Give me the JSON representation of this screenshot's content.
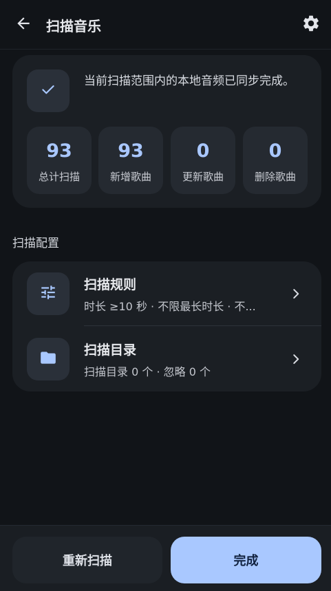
{
  "header": {
    "title": "扫描音乐",
    "back_icon": "arrow-back-icon",
    "settings_icon": "gear-icon"
  },
  "summary": {
    "message": "当前扫描范围内的本地音频已同步完成。",
    "status_icon": "checkmark-icon",
    "stats": [
      {
        "value": "93",
        "label": "总计扫描"
      },
      {
        "value": "93",
        "label": "新增歌曲"
      },
      {
        "value": "0",
        "label": "更新歌曲"
      },
      {
        "value": "0",
        "label": "删除歌曲"
      }
    ]
  },
  "config": {
    "section_title": "扫描配置",
    "items": [
      {
        "title": "扫描规则",
        "subtitle": "时长 ≥10 秒 · 不限最长时长 · 不...",
        "icon": "tune-sliders-icon"
      },
      {
        "title": "扫描目录",
        "subtitle": "扫描目录 0 个 · 忽略 0 个",
        "icon": "folder-icon"
      }
    ]
  },
  "footer": {
    "rescan_label": "重新扫描",
    "done_label": "完成"
  },
  "colors": {
    "background": "#111418",
    "card": "#1b1f24",
    "accent": "#a9c8ff",
    "stat_value": "#a9c7ff"
  }
}
